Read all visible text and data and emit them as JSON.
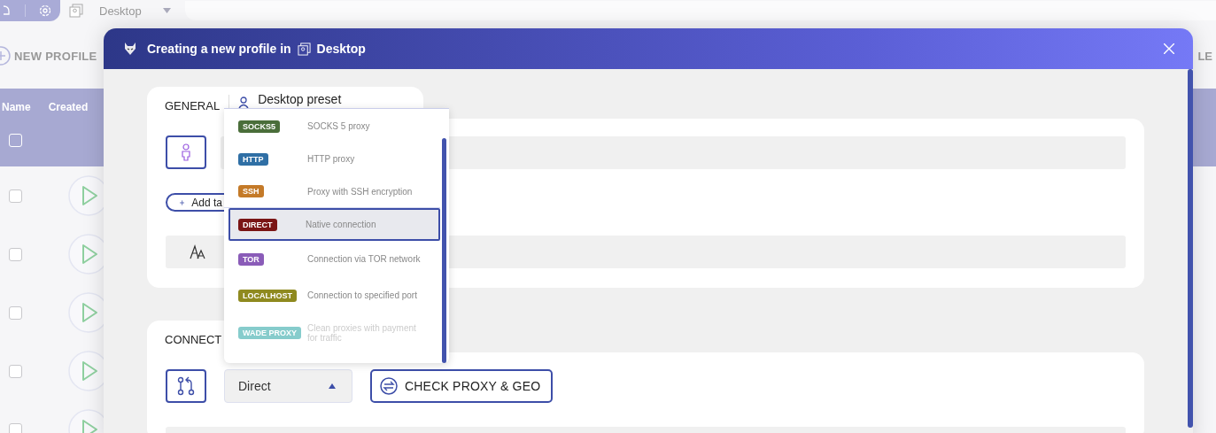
{
  "top_bar": {
    "workspace": "Desktop"
  },
  "background": {
    "new_profile": "NEW PROFILE",
    "right_button": "LE",
    "columns": [
      "Name",
      "Created"
    ],
    "header_checked": false,
    "rows": [
      {
        "checked": false
      },
      {
        "checked": false
      },
      {
        "checked": false
      },
      {
        "checked": false
      },
      {
        "checked": false
      }
    ]
  },
  "modal": {
    "title": "Creating a new profile in",
    "workspace": "Desktop",
    "general": {
      "title": "GENERAL",
      "preset": "Desktop preset",
      "add_tag": "Add ta"
    },
    "connection": {
      "title": "CONNECT",
      "proxy_type": "Direct",
      "check_button": "CHECK PROXY & GEO"
    }
  },
  "proxy_dropdown": [
    {
      "tag": "SOCKS5",
      "description": "SOCKS 5 proxy",
      "color": "#4a6e3a",
      "selected": false,
      "disabled": false
    },
    {
      "tag": "HTTP",
      "description": "HTTP proxy",
      "color": "#2f6fa5",
      "selected": false,
      "disabled": false
    },
    {
      "tag": "SSH",
      "description": "Proxy with SSH encryption",
      "color": "#c47a28",
      "selected": false,
      "disabled": false
    },
    {
      "tag": "DIRECT",
      "description": "Native connection",
      "color": "#7a1515",
      "selected": true,
      "disabled": false
    },
    {
      "tag": "TOR",
      "description": "Connection via TOR network",
      "color": "#8a5cb8",
      "selected": false,
      "disabled": false
    },
    {
      "tag": "LOCALHOST",
      "description": "Connection to specified port",
      "color": "#8f8a1f",
      "selected": false,
      "disabled": false
    },
    {
      "tag": "WADE PROXY",
      "description": "Clean proxies with payment for traffic",
      "color": "#86cccc",
      "selected": false,
      "disabled": true
    }
  ]
}
